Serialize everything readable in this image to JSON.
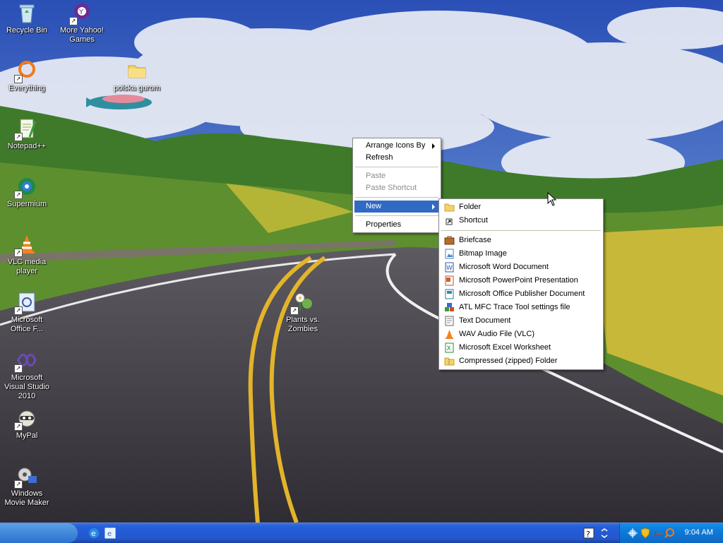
{
  "desktop": {
    "icons": [
      {
        "label": "Recycle Bin"
      },
      {
        "label": "More Yahoo! Games"
      },
      {
        "label": "Everything"
      },
      {
        "label": "polska gurom"
      },
      {
        "label": "Notepad++"
      },
      {
        "label": "Supermium"
      },
      {
        "label": "VLC media player"
      },
      {
        "label": "Microsoft Office F..."
      },
      {
        "label": "Plants vs. Zombies"
      },
      {
        "label": "Microsoft Visual Studio 2010"
      },
      {
        "label": "MyPal"
      },
      {
        "label": "Windows Movie Maker"
      }
    ]
  },
  "context_menu": {
    "items": [
      {
        "label": "Arrange Icons By"
      },
      {
        "label": "Refresh"
      },
      {
        "label": "Paste"
      },
      {
        "label": "Paste Shortcut"
      },
      {
        "label": "New"
      },
      {
        "label": "Properties"
      }
    ]
  },
  "new_submenu": {
    "items": [
      {
        "label": "Folder",
        "icon": "folder-icon"
      },
      {
        "label": "Shortcut",
        "icon": "shortcut-icon"
      },
      {
        "label": "Briefcase",
        "icon": "briefcase-icon"
      },
      {
        "label": "Bitmap Image",
        "icon": "bitmap-icon"
      },
      {
        "label": "Microsoft Word Document",
        "icon": "word-doc-icon"
      },
      {
        "label": "Microsoft PowerPoint Presentation",
        "icon": "powerpoint-icon"
      },
      {
        "label": "Microsoft Office Publisher Document",
        "icon": "publisher-icon"
      },
      {
        "label": "ATL MFC Trace Tool settings file",
        "icon": "atl-trace-icon"
      },
      {
        "label": "Text Document",
        "icon": "text-doc-icon"
      },
      {
        "label": "WAV Audio File (VLC)",
        "icon": "vlc-audio-icon"
      },
      {
        "label": "Microsoft Excel Worksheet",
        "icon": "excel-icon"
      },
      {
        "label": "Compressed (zipped) Folder",
        "icon": "zip-folder-icon"
      }
    ]
  },
  "taskbar": {
    "clock": "9:04 AM"
  },
  "colors": {
    "menu_highlight": "#316ac5",
    "taskbar": "#245edb",
    "tray": "#0f7ad8"
  }
}
